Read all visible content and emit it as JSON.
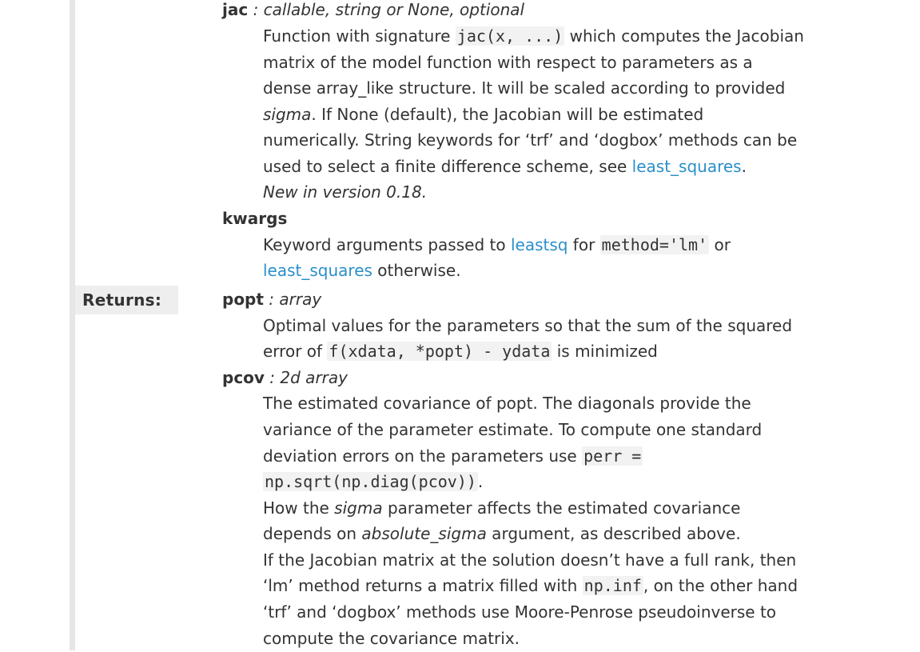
{
  "returns_label": "Returns:",
  "jac": {
    "name": "jac",
    "type": " : callable, string or None, optional",
    "l1_pre": "Function with signature ",
    "l1_code": "jac(x, ...)",
    "l1_post": " which computes the Jacobian",
    "l2": "matrix of the model function with respect to parameters as a",
    "l3": "dense array_like structure. It will be scaled according to provided",
    "l4_em": "sigma",
    "l4_post": ". If None (default), the Jacobian will be estimated",
    "l5": "numerically. String keywords for ‘trf’ and ‘dogbox’ methods can be",
    "l6_pre": "used to select a finite difference scheme, see ",
    "l6_link": "least_squares",
    "l6_post": ".",
    "l7": "New in version 0.18."
  },
  "kwargs": {
    "name": "kwargs",
    "l1_pre": "Keyword arguments passed to ",
    "l1_link": "leastsq",
    "l1_mid": " for ",
    "l1_code": "method='lm'",
    "l1_post": " or",
    "l2_link": "least_squares",
    "l2_post": " otherwise."
  },
  "popt": {
    "name": "popt",
    "type": " : array",
    "l1": "Optimal values for the parameters so that the sum of the squared",
    "l2_pre": "error of ",
    "l2_code": "f(xdata, *popt) - ydata",
    "l2_post": " is minimized"
  },
  "pcov": {
    "name": "pcov",
    "type": " : 2d array",
    "l1": "The estimated covariance of popt. The diagonals provide the",
    "l2": "variance of the parameter estimate. To compute one standard",
    "l3_pre": "deviation errors on the parameters use ",
    "l3_code": "perr =",
    "l4_code": "np.sqrt(np.diag(pcov))",
    "l4_post": ".",
    "l5_pre": "How the ",
    "l5_em": "sigma",
    "l5_post": " parameter affects the estimated covariance",
    "l6_pre": "depends on ",
    "l6_em": "absolute_sigma",
    "l6_post": " argument, as described above.",
    "l7": "If the Jacobian matrix at the solution doesn’t have a full rank, then",
    "l8_pre": "‘lm’ method returns a matrix filled with ",
    "l8_code": "np.inf",
    "l8_post": ", on the other hand",
    "l9": "‘trf’ and ‘dogbox’ methods use Moore-Penrose pseudoinverse to",
    "l10": "compute the covariance matrix."
  }
}
